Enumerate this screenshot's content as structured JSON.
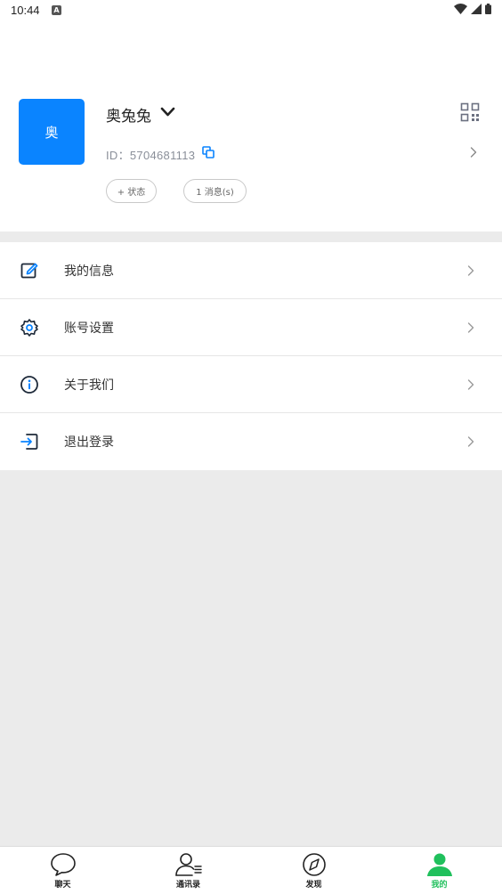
{
  "status_bar": {
    "time": "10:44",
    "app_icon": "A"
  },
  "profile": {
    "avatar_text": "奥",
    "username": "奥兔兔",
    "user_id": "ID：5704681113",
    "status_pill": "+ 状态",
    "messages_pill": "1 消息(s)",
    "accent_color": "#0a84ff"
  },
  "menu": {
    "items": [
      {
        "label": "我的信息",
        "icon": "edit-icon"
      },
      {
        "label": "账号设置",
        "icon": "gear-icon"
      },
      {
        "label": "关于我们",
        "icon": "info-icon"
      },
      {
        "label": "退出登录",
        "icon": "logout-icon"
      }
    ]
  },
  "tabbar": {
    "tabs": [
      {
        "label": "聊天",
        "icon": "chat-bubble-icon"
      },
      {
        "label": "通讯录",
        "icon": "contacts-icon"
      },
      {
        "label": "发现",
        "icon": "compass-icon"
      },
      {
        "label": "我的",
        "icon": "person-icon",
        "active": true
      }
    ],
    "active_color": "#20c05c"
  }
}
